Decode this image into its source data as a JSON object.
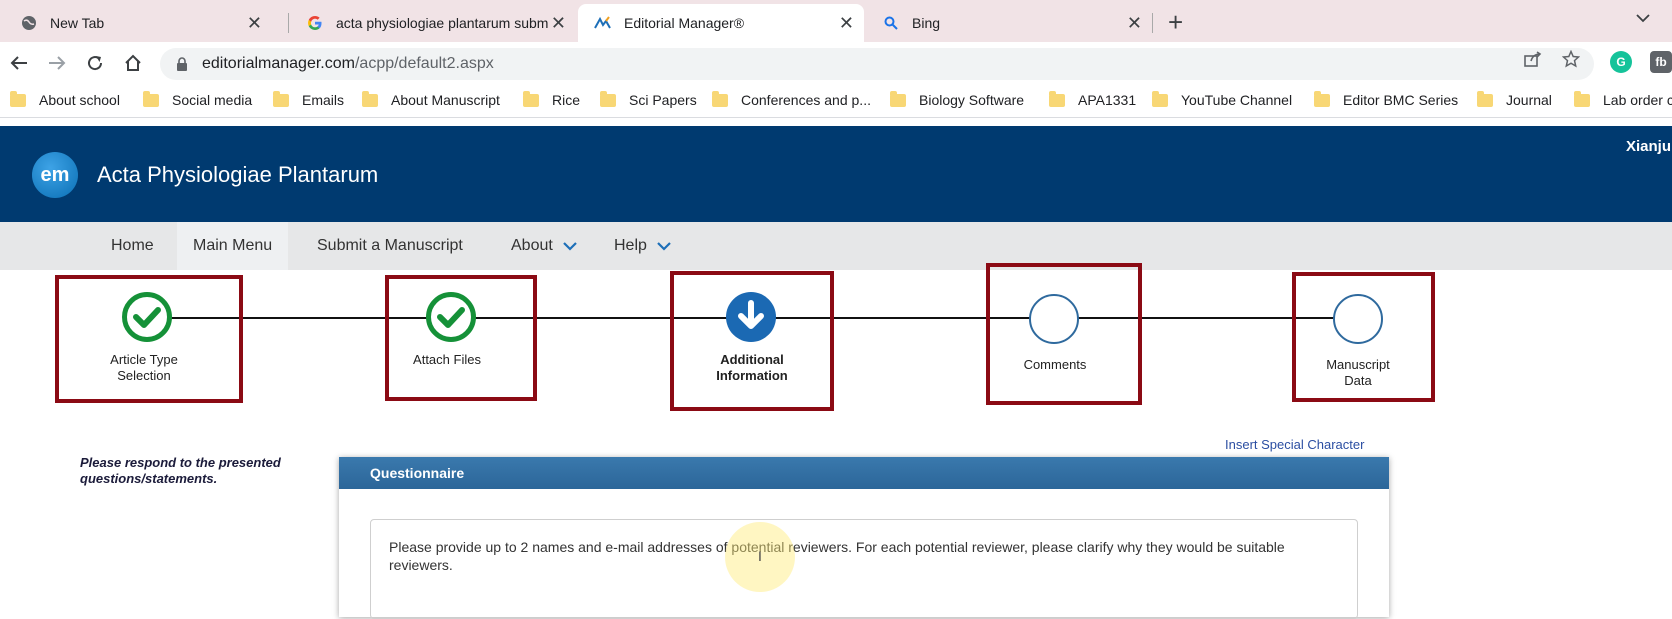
{
  "browser": {
    "tabs": [
      {
        "title": "New Tab",
        "icon": "globe-icon",
        "active": false
      },
      {
        "title": "acta physiologiae plantarum subm",
        "icon": "google-icon",
        "active": false
      },
      {
        "title": "Editorial Manager®",
        "icon": "em-icon",
        "active": true
      },
      {
        "title": "Bing",
        "icon": "search-icon",
        "active": false
      }
    ],
    "new_tab_symbol": "+",
    "close_symbol": "✕",
    "url_host": "editorialmanager.com",
    "url_path": "/acpp/default2.aspx",
    "bookmarks": [
      "About school",
      "Social media",
      "Emails",
      "About Manuscript",
      "Rice",
      "Sci Papers",
      "Conferences and p...",
      "Biology Software",
      "APA1331",
      "YouTube Channel",
      "Editor BMC Series",
      "Journal",
      "Lab order c"
    ]
  },
  "header": {
    "logo_text": "em",
    "journal_title": "Acta Physiologiae Plantarum",
    "user_name": "Xianju"
  },
  "nav": {
    "items": [
      {
        "label": "Home",
        "dropdown": false
      },
      {
        "label": "Main Menu",
        "dropdown": false
      },
      {
        "label": "Submit a Manuscript",
        "dropdown": false
      },
      {
        "label": "About",
        "dropdown": true
      },
      {
        "label": "Help",
        "dropdown": true
      }
    ]
  },
  "steps": [
    {
      "label_line1": "Article Type",
      "label_line2": "Selection",
      "state": "done"
    },
    {
      "label_line1": "Attach Files",
      "label_line2": "",
      "state": "done"
    },
    {
      "label_line1": "Additional",
      "label_line2": "Information",
      "state": "current"
    },
    {
      "label_line1": "Comments",
      "label_line2": "",
      "state": "todo"
    },
    {
      "label_line1": "Manuscript",
      "label_line2": "Data",
      "state": "todo"
    }
  ],
  "content": {
    "instructions": "Please respond to the presented questions/statements.",
    "insert_special_character": "Insert Special Character",
    "questionnaire_title": "Questionnaire",
    "question_text": "Please provide up to 2 names and e-mail addresses of potential reviewers. For each potential reviewer, please clarify why they would be suitable reviewers."
  },
  "colors": {
    "header_bg": "#003a70",
    "step_highlight": "#8b0a14",
    "step_done": "#159138",
    "step_current": "#1b69b3"
  }
}
